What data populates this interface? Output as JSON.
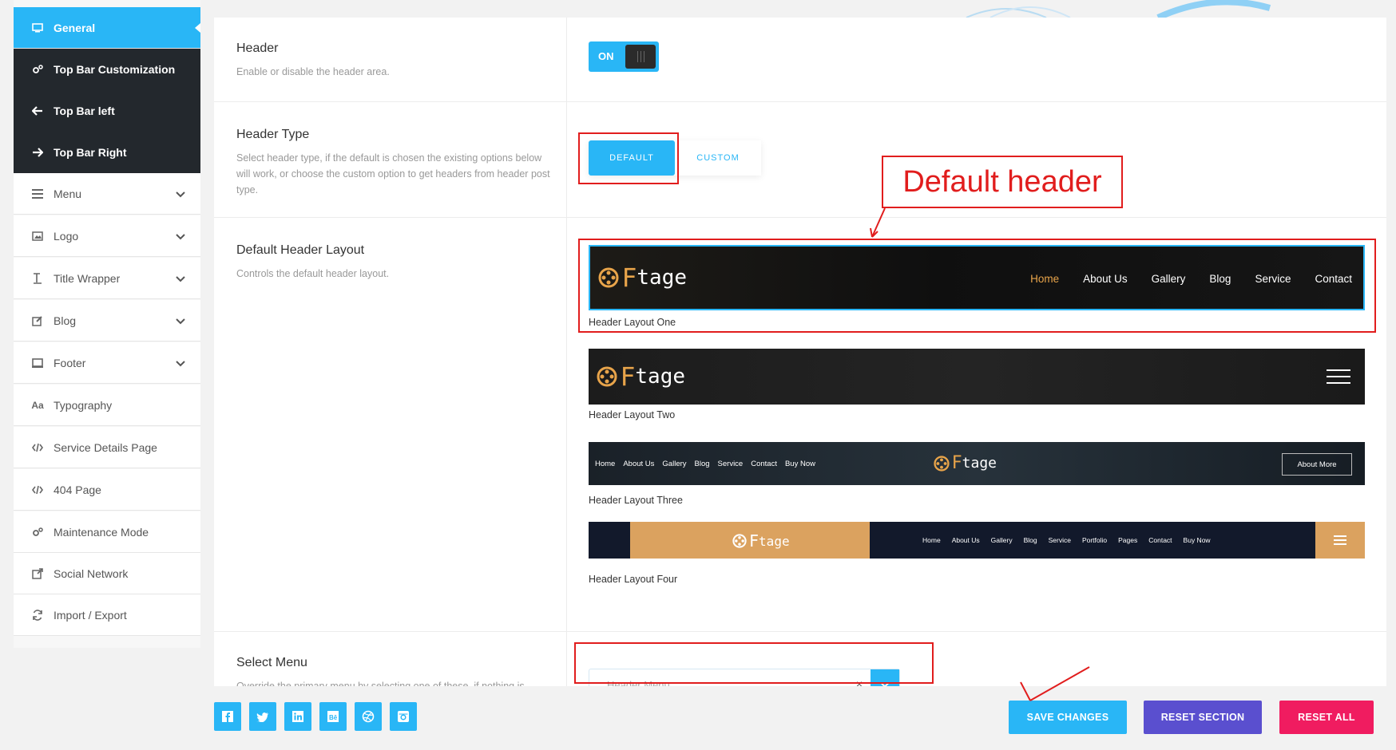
{
  "colors": {
    "accent": "#29b6f6",
    "dark": "#23282d",
    "annotation": "#e11d1d",
    "reset_section": "#5a4fcf",
    "reset_all": "#f01c60"
  },
  "sidebar": {
    "items": [
      {
        "label": "General",
        "icon": "monitor-icon"
      },
      {
        "label": "Top Bar Customization",
        "icon": "gears-icon"
      },
      {
        "label": "Top Bar left",
        "icon": "arrow-left-icon"
      },
      {
        "label": "Top Bar Right",
        "icon": "arrow-right-icon"
      },
      {
        "label": "Menu",
        "icon": "menu-icon"
      },
      {
        "label": "Logo",
        "icon": "image-icon"
      },
      {
        "label": "Title Wrapper",
        "icon": "text-height-icon"
      },
      {
        "label": "Blog",
        "icon": "edit-icon"
      },
      {
        "label": "Footer",
        "icon": "laptop-icon"
      },
      {
        "label": "Typography",
        "icon": "typography-icon"
      },
      {
        "label": "Service Details Page",
        "icon": "code-icon"
      },
      {
        "label": "404 Page",
        "icon": "code-icon"
      },
      {
        "label": "Maintenance Mode",
        "icon": "gears-icon"
      },
      {
        "label": "Social Network",
        "icon": "share-icon"
      },
      {
        "label": "Import / Export",
        "icon": "refresh-icon"
      }
    ]
  },
  "options": {
    "header": {
      "title": "Header",
      "desc": "Enable or disable the header area.",
      "toggle_label": "ON"
    },
    "header_type": {
      "title": "Header Type",
      "desc": "Select header type, if the default is chosen the existing options below will work, or choose the custom option to get headers from header post type.",
      "default_label": "DEFAULT",
      "custom_label": "CUSTOM"
    },
    "default_layout": {
      "title": "Default Header Layout",
      "desc": "Controls the default header layout.",
      "layouts": [
        {
          "caption": "Header Layout One",
          "nav": [
            "Home",
            "About Us",
            "Gallery",
            "Blog",
            "Service",
            "Contact"
          ]
        },
        {
          "caption": "Header Layout Two"
        },
        {
          "caption": "Header Layout Three",
          "nav": [
            "Home",
            "About Us",
            "Gallery",
            "Blog",
            "Service",
            "Contact",
            "Buy Now"
          ],
          "button": "About More"
        },
        {
          "caption": "Header Layout Four",
          "nav": [
            "Home",
            "About Us",
            "Gallery",
            "Blog",
            "Service",
            "Portfolio",
            "Pages",
            "Contact",
            "Buy Now"
          ]
        }
      ],
      "logo": {
        "letter": "F",
        "rest": "tage"
      }
    },
    "select_menu": {
      "title": "Select Menu",
      "desc": "Override the primary menu by selecting one of these, if nothing is selected primary menu will work.",
      "placeholder": "Header Menu",
      "clear": "×"
    }
  },
  "annotation": {
    "label": "Default header"
  },
  "footer": {
    "social": [
      "facebook-icon",
      "twitter-icon",
      "linkedin-icon",
      "behance-icon",
      "dribbble-icon",
      "instagram-icon"
    ],
    "save_label": "SAVE CHANGES",
    "reset_section_label": "RESET SECTION",
    "reset_all_label": "RESET ALL"
  }
}
